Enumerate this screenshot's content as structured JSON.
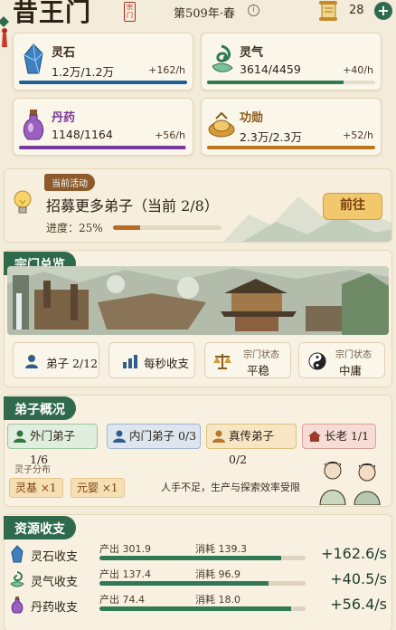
{
  "header": {
    "sect_name": "昔王门",
    "seal_text": "宗门",
    "era": "第509年·春",
    "info_icon": "info-icon",
    "scroll_count": "28",
    "plus_label": "+"
  },
  "resources": [
    {
      "name": "灵石",
      "value": "1.2万/1.2万",
      "rate": "+162/h",
      "fill": 1.0,
      "color": "#1f5f9a",
      "icon": "spirit-stone-icon"
    },
    {
      "name": "灵气",
      "value": "3614/4459",
      "rate": "+40/h",
      "fill": 0.81,
      "color": "#2f7a52",
      "icon": "spirit-qi-icon"
    },
    {
      "name": "丹药",
      "value": "1148/1164",
      "rate": "+56/h",
      "fill": 0.99,
      "color": "#7a3a9a",
      "icon": "elixir-icon"
    },
    {
      "name": "功勋",
      "value": "2.3万/2.3万",
      "rate": "+52/h",
      "fill": 1.0,
      "color": "#c0761e",
      "icon": "merit-icon"
    }
  ],
  "activity": {
    "tag": "当前活动",
    "title": "招募更多弟子（当前 2/8）",
    "progress_label": "进度：25%",
    "progress": 0.25,
    "button": "前往"
  },
  "sect_overview": {
    "title": "宗门总览",
    "buttons": [
      {
        "label": "弟子 2/12",
        "icon": "person-icon"
      },
      {
        "label": "每秒收支",
        "icon": "bar-chart-icon"
      },
      {
        "label_top": "宗门状态",
        "label": "平稳",
        "icon": "scales-icon"
      },
      {
        "label_top": "宗门状态",
        "label": "中庸",
        "icon": "yin-yang-icon"
      }
    ]
  },
  "disciples": {
    "title": "弟子概况",
    "chips": [
      {
        "label": "外门弟子 1/6",
        "icon": "person-icon",
        "bg": "#dfeede",
        "border": "#9cc79a",
        "icon_color": "#2f7a3a"
      },
      {
        "label": "内门弟子 0/3",
        "icon": "person-icon",
        "bg": "#dde6ef",
        "border": "#9fb6cc",
        "icon_color": "#2f5f8a"
      },
      {
        "label": "真传弟子 0/2",
        "icon": "person-icon",
        "bg": "#f6e6c4",
        "border": "#e0bf7c",
        "icon_color": "#b9772a"
      },
      {
        "label": "长老 1/1",
        "icon": "elder-icon",
        "bg": "#f6dcd6",
        "border": "#d9a196",
        "icon_color": "#9a3a2a"
      }
    ],
    "realm_label": "灵子分布",
    "realms": [
      "灵基 ×1",
      "元婴 ×1"
    ],
    "note": "人手不足，生产与探索效率受限"
  },
  "income": {
    "title": "资源收支",
    "rows": [
      {
        "name": "灵石收支",
        "produce": "产出 301.9",
        "consume": "消耗 139.3",
        "total": "+162.6/s",
        "fill": 0.88,
        "icon": "spirit-stone-icon",
        "color": "#1f5f9a"
      },
      {
        "name": "灵气收支",
        "produce": "产出 137.4",
        "consume": "消耗 96.9",
        "total": "+40.5/s",
        "fill": 0.82,
        "icon": "spirit-qi-icon",
        "color": "#2f7a52"
      },
      {
        "name": "丹药收支",
        "produce": "产出 74.4",
        "consume": "消耗 18.0",
        "total": "+56.4/s",
        "fill": 0.93,
        "icon": "elixir-icon",
        "color": "#7a3a9a"
      }
    ]
  }
}
